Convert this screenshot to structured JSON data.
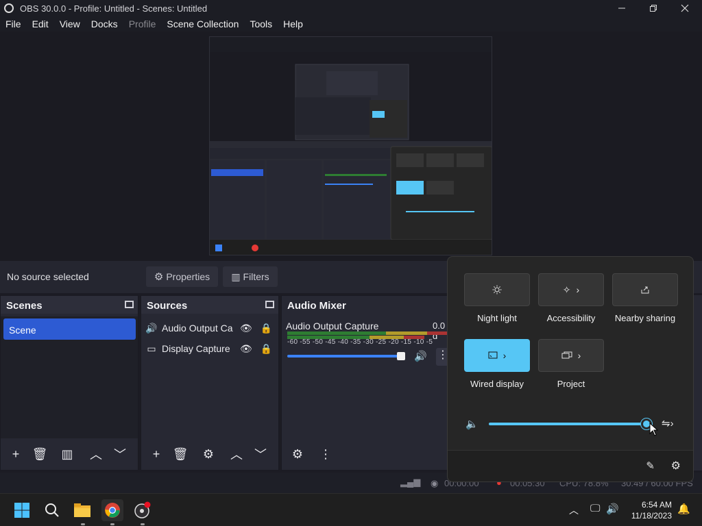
{
  "window": {
    "title": "OBS 30.0.0 - Profile: Untitled - Scenes: Untitled",
    "minimize_icon": "minimize-icon",
    "maximize_icon": "restore-icon",
    "close_icon": "close-icon"
  },
  "menu": {
    "items": [
      "File",
      "Edit",
      "View",
      "Docks",
      "Profile",
      "Scene Collection",
      "Tools",
      "Help"
    ],
    "disabled": [
      "Profile"
    ]
  },
  "context_bar": {
    "status": "No source selected",
    "properties_label": "Properties",
    "filters_label": "Filters"
  },
  "scenes": {
    "title": "Scenes",
    "items": [
      "Scene"
    ]
  },
  "sources": {
    "title": "Sources",
    "items": [
      {
        "name": "Audio Output Ca",
        "icon": "speaker-icon"
      },
      {
        "name": "Display Capture",
        "icon": "monitor-icon"
      }
    ]
  },
  "audio_mixer": {
    "title": "Audio Mixer",
    "channel_name": "Audio Output Capture",
    "level": "0.0 d",
    "ticks": "-60 -55 -50 -45 -40 -35 -30 -25 -20 -15 -10 -5"
  },
  "status_bar": {
    "dropped": "00:00:00",
    "rec_time": "00:05:30",
    "cpu": "CPU: 78.8%",
    "fps": "30.49 / 60.00 FPS"
  },
  "quick_settings": {
    "tiles": [
      {
        "label": "Night light",
        "icon": "sun-icon",
        "on": false
      },
      {
        "label": "Accessibility",
        "icon": "accessibility-icon",
        "on": false
      },
      {
        "label": "Nearby sharing",
        "icon": "share-icon",
        "on": false
      },
      {
        "label": "Wired display",
        "icon": "cast-icon",
        "on": true
      },
      {
        "label": "Project",
        "icon": "project-icon",
        "on": false
      }
    ],
    "volume_level": 1.0,
    "accent": "#56c6f5"
  },
  "taskbar": {
    "time": "6:54 AM",
    "date": "11/18/2023"
  }
}
